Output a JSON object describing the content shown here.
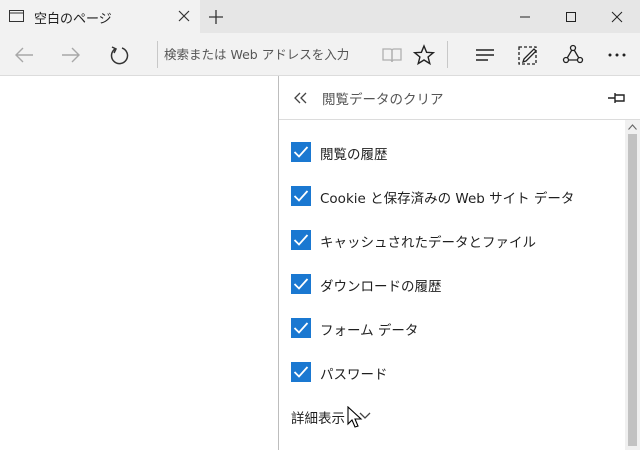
{
  "tab": {
    "title": "空白のページ",
    "icon": "page-icon"
  },
  "window_controls": [
    "minimize-icon",
    "maximize-icon",
    "close-icon"
  ],
  "navbar": {
    "address_placeholder": "検索または Web アドレスを入力",
    "buttons": [
      "back-icon",
      "forward-icon",
      "refresh-icon",
      "reading-view-icon",
      "favorite-star-icon",
      "hub-icon",
      "web-note-icon",
      "share-icon",
      "more-icon"
    ]
  },
  "pane": {
    "title": "閲覧データのクリア",
    "options": [
      {
        "label": "閲覧の履歴",
        "checked": true
      },
      {
        "label": "Cookie と保存済みの Web サイト データ",
        "checked": true
      },
      {
        "label": "キャッシュされたデータとファイル",
        "checked": true
      },
      {
        "label": "ダウンロードの履歴",
        "checked": true
      },
      {
        "label": "フォーム データ",
        "checked": true
      },
      {
        "label": "パスワード",
        "checked": true
      }
    ],
    "more_label": "詳細表示"
  },
  "colors": {
    "checkbox": "#1a78d1",
    "titlebar": "#e6e6e6",
    "toolbar": "#f2f2f2"
  }
}
